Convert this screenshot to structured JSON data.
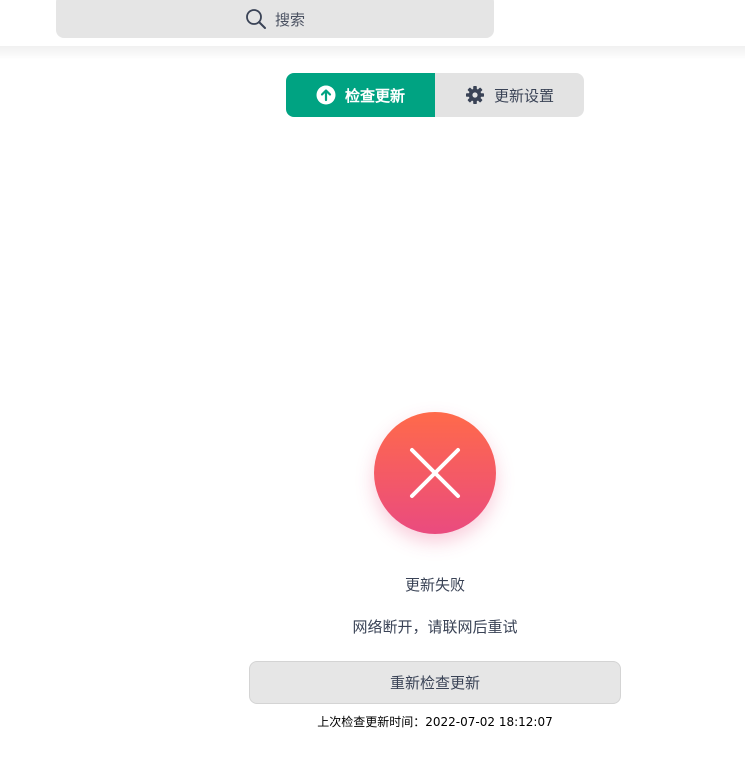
{
  "search": {
    "label": "搜索",
    "icon": "search-icon"
  },
  "tabs": [
    {
      "label": "检查更新",
      "icon": "arrow-up-circle-icon",
      "active": true
    },
    {
      "label": "更新设置",
      "icon": "gear-icon",
      "active": false
    }
  ],
  "status": {
    "icon": "error-x-icon",
    "title": "更新失败",
    "message": "网络断开，请联网后重试"
  },
  "retry_button": {
    "label": "重新检查更新"
  },
  "last_check": {
    "text": "上次检查更新时间：2022-07-02 18:12:07"
  },
  "colors": {
    "accent": "#00a382",
    "error_top": "#ff6a4a",
    "error_bottom": "#ea4b7f",
    "button_bg": "#e6e6e6"
  }
}
